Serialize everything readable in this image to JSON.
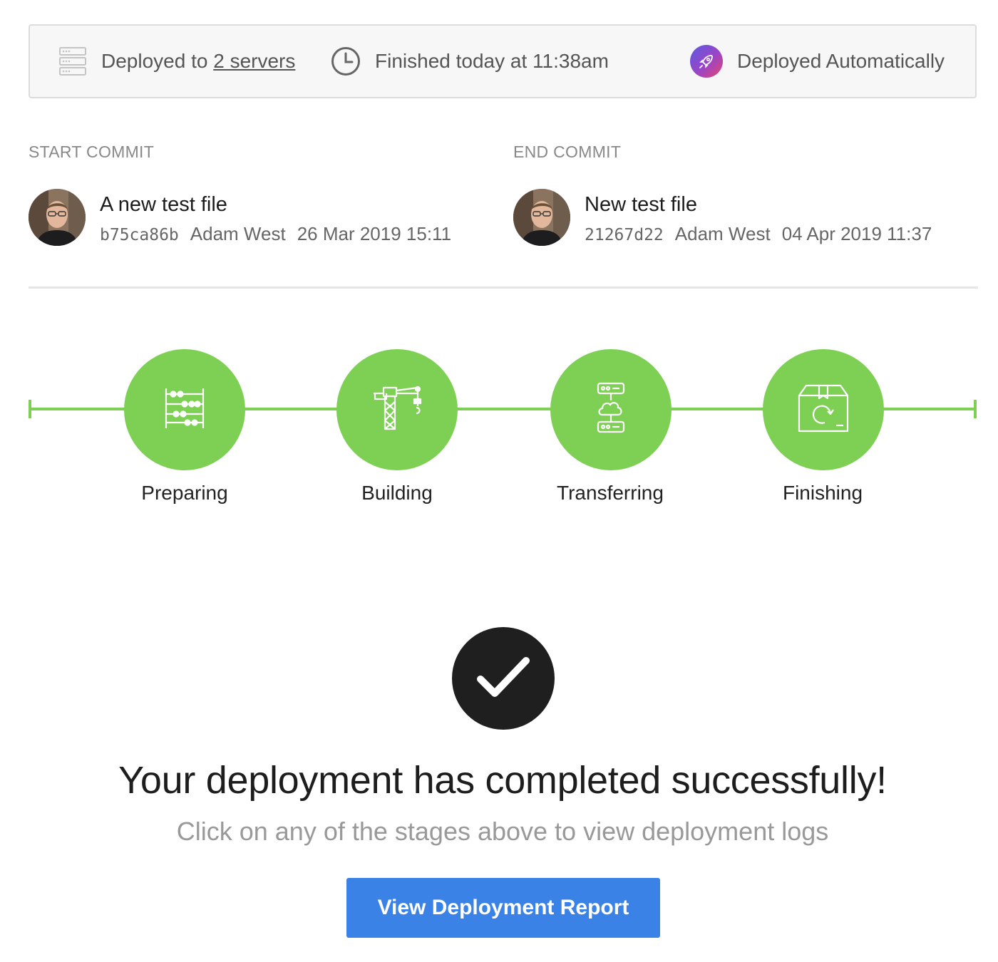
{
  "info": {
    "servers_prefix": "Deployed to",
    "servers_link": "2 servers",
    "finished": "Finished today at 11:38am",
    "trigger": "Deployed Automatically",
    "icons": [
      "server-stack-icon",
      "clock-icon",
      "rocket-icon"
    ]
  },
  "start_commit": {
    "label": "START COMMIT",
    "message": "A new test file",
    "hash": "b75ca86b",
    "author": "Adam West",
    "date": "26 Mar 2019 15:11"
  },
  "end_commit": {
    "label": "END COMMIT",
    "message": "New test file",
    "hash": "21267d22",
    "author": "Adam West",
    "date": "04 Apr 2019 11:37"
  },
  "stages": [
    {
      "label": "Preparing",
      "icon": "abacus-icon"
    },
    {
      "label": "Building",
      "icon": "crane-icon"
    },
    {
      "label": "Transferring",
      "icon": "cloud-transfer-icon"
    },
    {
      "label": "Finishing",
      "icon": "package-icon"
    }
  ],
  "success": {
    "title": "Your deployment has completed successfully!",
    "subtitle": "Click on any of the stages above to view deployment logs",
    "button": "View Deployment Report"
  },
  "colors": {
    "stage_green": "#7ed055",
    "button_blue": "#3b82e6",
    "check_dark": "#1f1f1f"
  }
}
